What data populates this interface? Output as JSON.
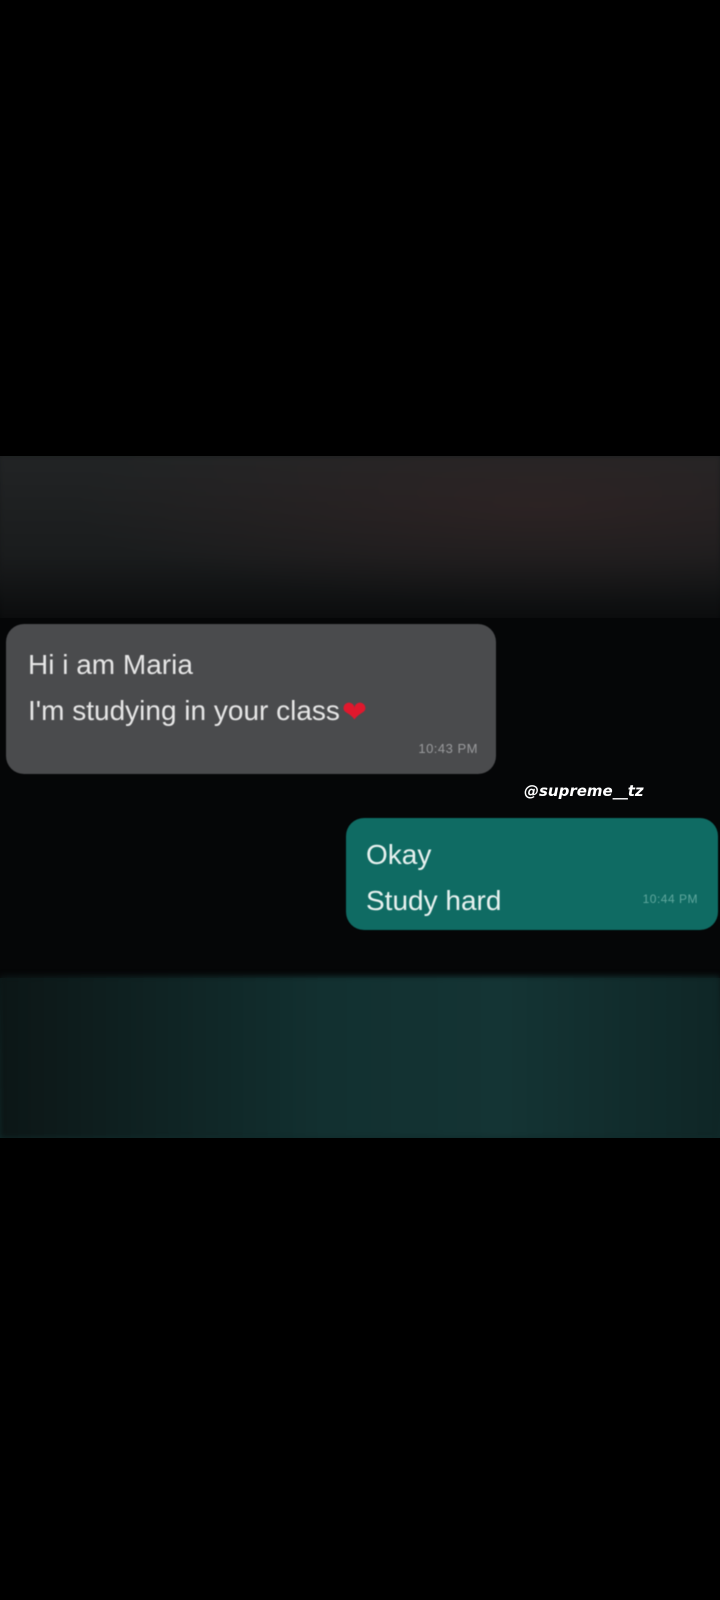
{
  "conversation": {
    "incoming": {
      "lines": [
        "Hi i am Maria",
        "I'm studying in your class"
      ],
      "emoji": "red-heart",
      "time": "10:43 PM"
    },
    "outgoing": {
      "lines": [
        "Okay",
        "Study hard"
      ],
      "time": "10:44 PM"
    }
  },
  "watermark": "@supreme__tz",
  "colors": {
    "incoming_bubble": "#4a4b4d",
    "outgoing_bubble": "#0f6b63",
    "background": "#000000",
    "heart": "#e0182d"
  }
}
